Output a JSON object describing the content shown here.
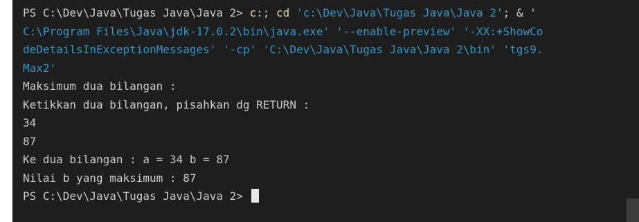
{
  "terminal": {
    "command": {
      "prompt": "PS C:\\Dev\\Java\\Tugas Java\\Java 2> ",
      "cmd_drive": "c:",
      "sep": "; ",
      "cmd_cd": "cd",
      "arg_path": " 'c:\\Dev\\Java\\Tugas Java\\Java 2'",
      "amp": "; & '",
      "wrap1": "C:\\Program Files\\Java\\jdk-17.0.2\\bin\\java.exe' '--enable-preview' '-XX:+ShowCo",
      "wrap2": "deDetailsInExceptionMessages' '-cp' 'C:\\Dev\\Java\\Tugas Java\\Java 2\\bin' 'tgs9.",
      "wrap3": "Max2'"
    },
    "output": [
      "Maksimum dua bilangan :",
      "Ketikkan dua bilangan, pisahkan dg RETURN :",
      "34",
      "87",
      "Ke dua bilangan : a = 34 b = 87",
      "Nilai b yang maksimum : 87"
    ],
    "final_prompt": "PS C:\\Dev\\Java\\Tugas Java\\Java 2> ",
    "colors": {
      "background": "#1e1e1e",
      "text": "#cccccc",
      "command": "#dcdcaa",
      "argument": "#3794c4"
    }
  }
}
